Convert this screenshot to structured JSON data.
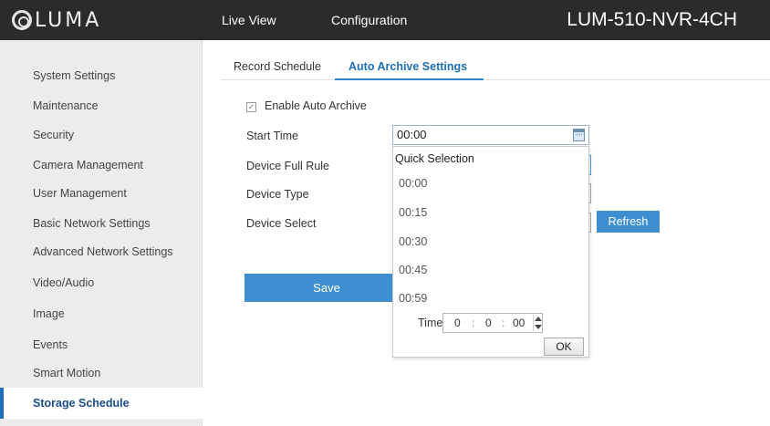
{
  "header": {
    "logo_text": "LUMA",
    "nav": [
      "Live View",
      "Configuration"
    ],
    "device_name": "LUM-510-NVR-4CH"
  },
  "sidebar": {
    "items": [
      {
        "label": "System Settings"
      },
      {
        "label": "Maintenance"
      },
      {
        "label": "Security"
      },
      {
        "label": "Camera Management"
      },
      {
        "label": "User Management"
      },
      {
        "label": "Basic Network Settings"
      },
      {
        "label": "Advanced Network Settings"
      },
      {
        "label": "Video/Audio"
      },
      {
        "label": "Image"
      },
      {
        "label": "Events"
      },
      {
        "label": "Smart Motion"
      },
      {
        "label": "Storage Schedule",
        "active": true
      }
    ]
  },
  "tabs": [
    {
      "label": "Record Schedule"
    },
    {
      "label": "Auto Archive Settings",
      "active": true
    }
  ],
  "form": {
    "enable_label": "Enable Auto Archive",
    "enable_checked": true,
    "start_time_label": "Start Time",
    "start_time_value": "00:00",
    "device_full_rule_label": "Device Full Rule",
    "device_type_label": "Device Type",
    "device_select_label": "Device Select",
    "refresh_label": "Refresh",
    "save_label": "Save"
  },
  "quick_selection": {
    "title": "Quick Selection",
    "options": [
      "00:00",
      "00:15",
      "00:30",
      "00:45",
      "00:59"
    ],
    "time_label": "Time",
    "hour": "0",
    "minute": "0",
    "second": "00",
    "ok_label": "OK"
  },
  "colors": {
    "header_bg": "#2b2b2b",
    "accent": "#3d8fd1",
    "active_text": "#1b4d8a",
    "sidebar_bg": "#ececec"
  }
}
